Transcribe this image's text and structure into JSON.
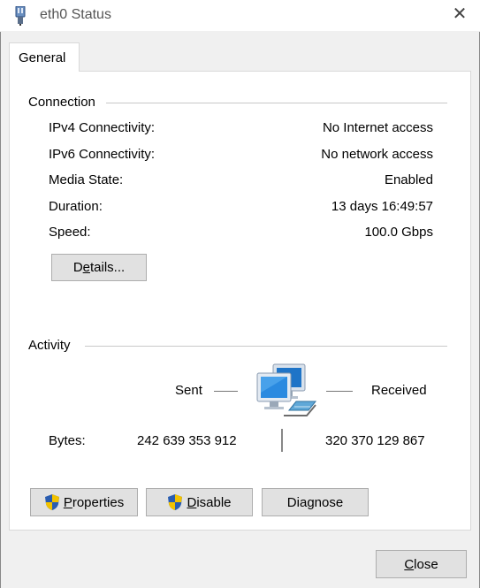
{
  "window": {
    "title": "eth0 Status",
    "close_glyph": "✕"
  },
  "tabs": [
    {
      "label": "General",
      "selected": true
    }
  ],
  "connection": {
    "heading": "Connection",
    "rows": [
      {
        "label": "IPv4 Connectivity:",
        "value": "No Internet access"
      },
      {
        "label": "IPv6 Connectivity:",
        "value": "No network access"
      },
      {
        "label": "Media State:",
        "value": "Enabled"
      },
      {
        "label": "Duration:",
        "value": "13 days 16:49:57"
      },
      {
        "label": "Speed:",
        "value": "100.0 Gbps"
      }
    ],
    "details_button": {
      "pre": "D",
      "ul": "e",
      "post": "tails..."
    }
  },
  "activity": {
    "heading": "Activity",
    "sent_label": "Sent",
    "received_label": "Received",
    "bytes_label": "Bytes:",
    "bytes_sent": "242 639 353 912",
    "bytes_received": "320 370 129 867",
    "icon": "network-computers-icon"
  },
  "buttons": {
    "properties": {
      "ul": "P",
      "post": "roperties",
      "icon": "uac-shield-icon"
    },
    "disable": {
      "ul": "D",
      "post": "isable",
      "icon": "uac-shield-icon"
    },
    "diagnose": {
      "pre": "Dia",
      "ul": "g",
      "post": "nose"
    },
    "close": {
      "ul": "C",
      "post": "lose"
    }
  },
  "colors": {
    "shield_blue": "#2a5db0",
    "shield_yellow": "#f2c200",
    "monitor_blue": "#1f74c7"
  }
}
